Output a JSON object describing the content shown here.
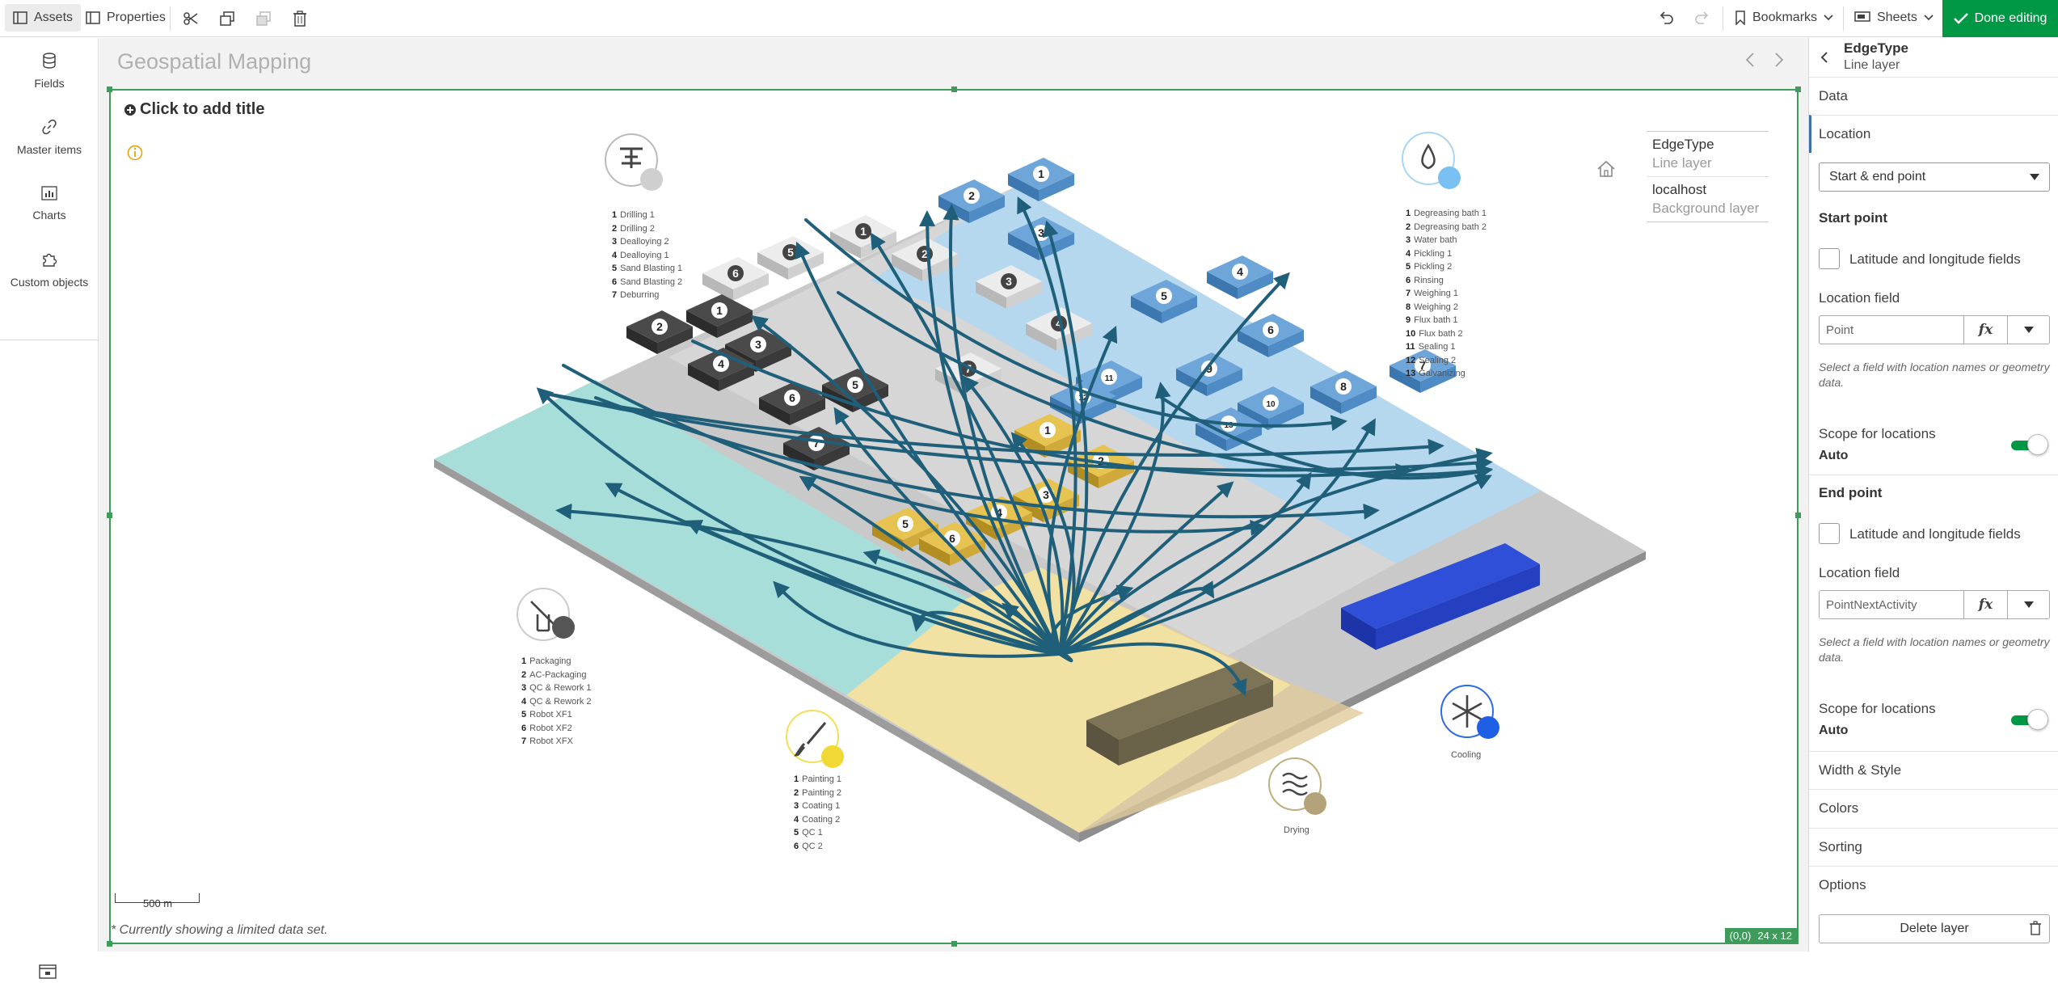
{
  "toolbar": {
    "assets_label": "Assets",
    "properties_label": "Properties",
    "bookmarks_label": "Bookmarks",
    "sheets_label": "Sheets",
    "done_label": "Done editing"
  },
  "leftnav": {
    "items": [
      {
        "label": "Fields",
        "icon": "database-icon"
      },
      {
        "label": "Master items",
        "icon": "link-icon"
      },
      {
        "label": "Charts",
        "icon": "bar-chart-icon"
      },
      {
        "label": "Custom objects",
        "icon": "puzzle-icon"
      }
    ]
  },
  "sheet": {
    "title": "Geospatial Mapping"
  },
  "map": {
    "add_title": "Click to add title",
    "footnote": "* Currently showing a limited data set.",
    "scale_label": "500 m",
    "coords": "(0,0)",
    "grid_size": "24 x 12",
    "legend": [
      {
        "title": "EdgeType",
        "subtitle": "Line layer"
      },
      {
        "title": "localhost",
        "subtitle": "Background layer"
      }
    ],
    "zones": {
      "drilling": [
        "Drilling 1",
        "Drilling 2",
        "Dealloying 2",
        "Dealloying 1",
        "Sand Blasting 1",
        "Sand Blasting 2",
        "Deburring"
      ],
      "degreasing": [
        "Degreasing  bath 1",
        "Degreasing  bath 2",
        "Water bath",
        "Pickling 1",
        "Pickling 2",
        "Rinsing",
        "Weighing 1",
        "Weighing 2",
        "Flux bath 1",
        "Flux bath 2",
        "Sealing 1",
        "Sealing 2",
        "Galvanizing"
      ],
      "packaging": [
        "Packaging",
        "AC-Packaging",
        "QC & Rework 1",
        "QC & Rework 2",
        "Robot XF1",
        "Robot XF2",
        "Robot XFX"
      ],
      "painting": [
        "Painting 1",
        "Painting 2",
        "Coating 1",
        "Coating 2",
        "QC 1",
        "QC 2"
      ],
      "cooling_label": "Cooling",
      "drying_label": "Drying"
    },
    "colors": {
      "edge": "#1f5f7a",
      "blue_zone": "#b5d8ef",
      "teal_zone": "#a8ded9",
      "yellow_zone": "#f1e1a3",
      "grey_zone": "#d4d4d4"
    }
  },
  "panel": {
    "title": "EdgeType",
    "subtitle": "Line layer",
    "sections": {
      "data": "Data",
      "location": "Location",
      "width_style": "Width & Style",
      "colors": "Colors",
      "sorting": "Sorting",
      "options": "Options"
    },
    "location_mode": "Start & end point",
    "start_point": {
      "heading": "Start point",
      "latlon_label": "Latitude and longitude fields",
      "field_label": "Location field",
      "field_value": "Point",
      "hint": "Select a field with location names or geometry data.",
      "scope_label": "Scope for locations",
      "scope_value": "Auto"
    },
    "end_point": {
      "heading": "End point",
      "latlon_label": "Latitude and longitude fields",
      "field_label": "Location field",
      "field_value": "PointNextActivity",
      "hint": "Select a field with location names or geometry data.",
      "scope_label": "Scope for locations",
      "scope_value": "Auto"
    },
    "fx_label": "fx",
    "delete_label": "Delete layer"
  }
}
